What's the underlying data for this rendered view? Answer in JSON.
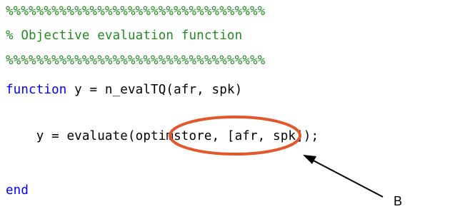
{
  "code": {
    "separator_top": "%%%%%%%%%%%%%%%%%%%%%%%%%%%%%%%%%%",
    "comment_title": "% Objective evaluation function",
    "separator_bottom": "%%%%%%%%%%%%%%%%%%%%%%%%%%%%%%%%%%",
    "keyword_function": "function",
    "signature": " y = n_evalTQ(afr, spk)",
    "body_prefix": "    y = evaluate(",
    "body_highlight": "optimstore,",
    "body_suffix": " [afr, spk]);",
    "keyword_end": "end"
  },
  "annotation": {
    "label": "B",
    "ellipse_color": "#e2572b",
    "arrow_color": "#000000"
  }
}
